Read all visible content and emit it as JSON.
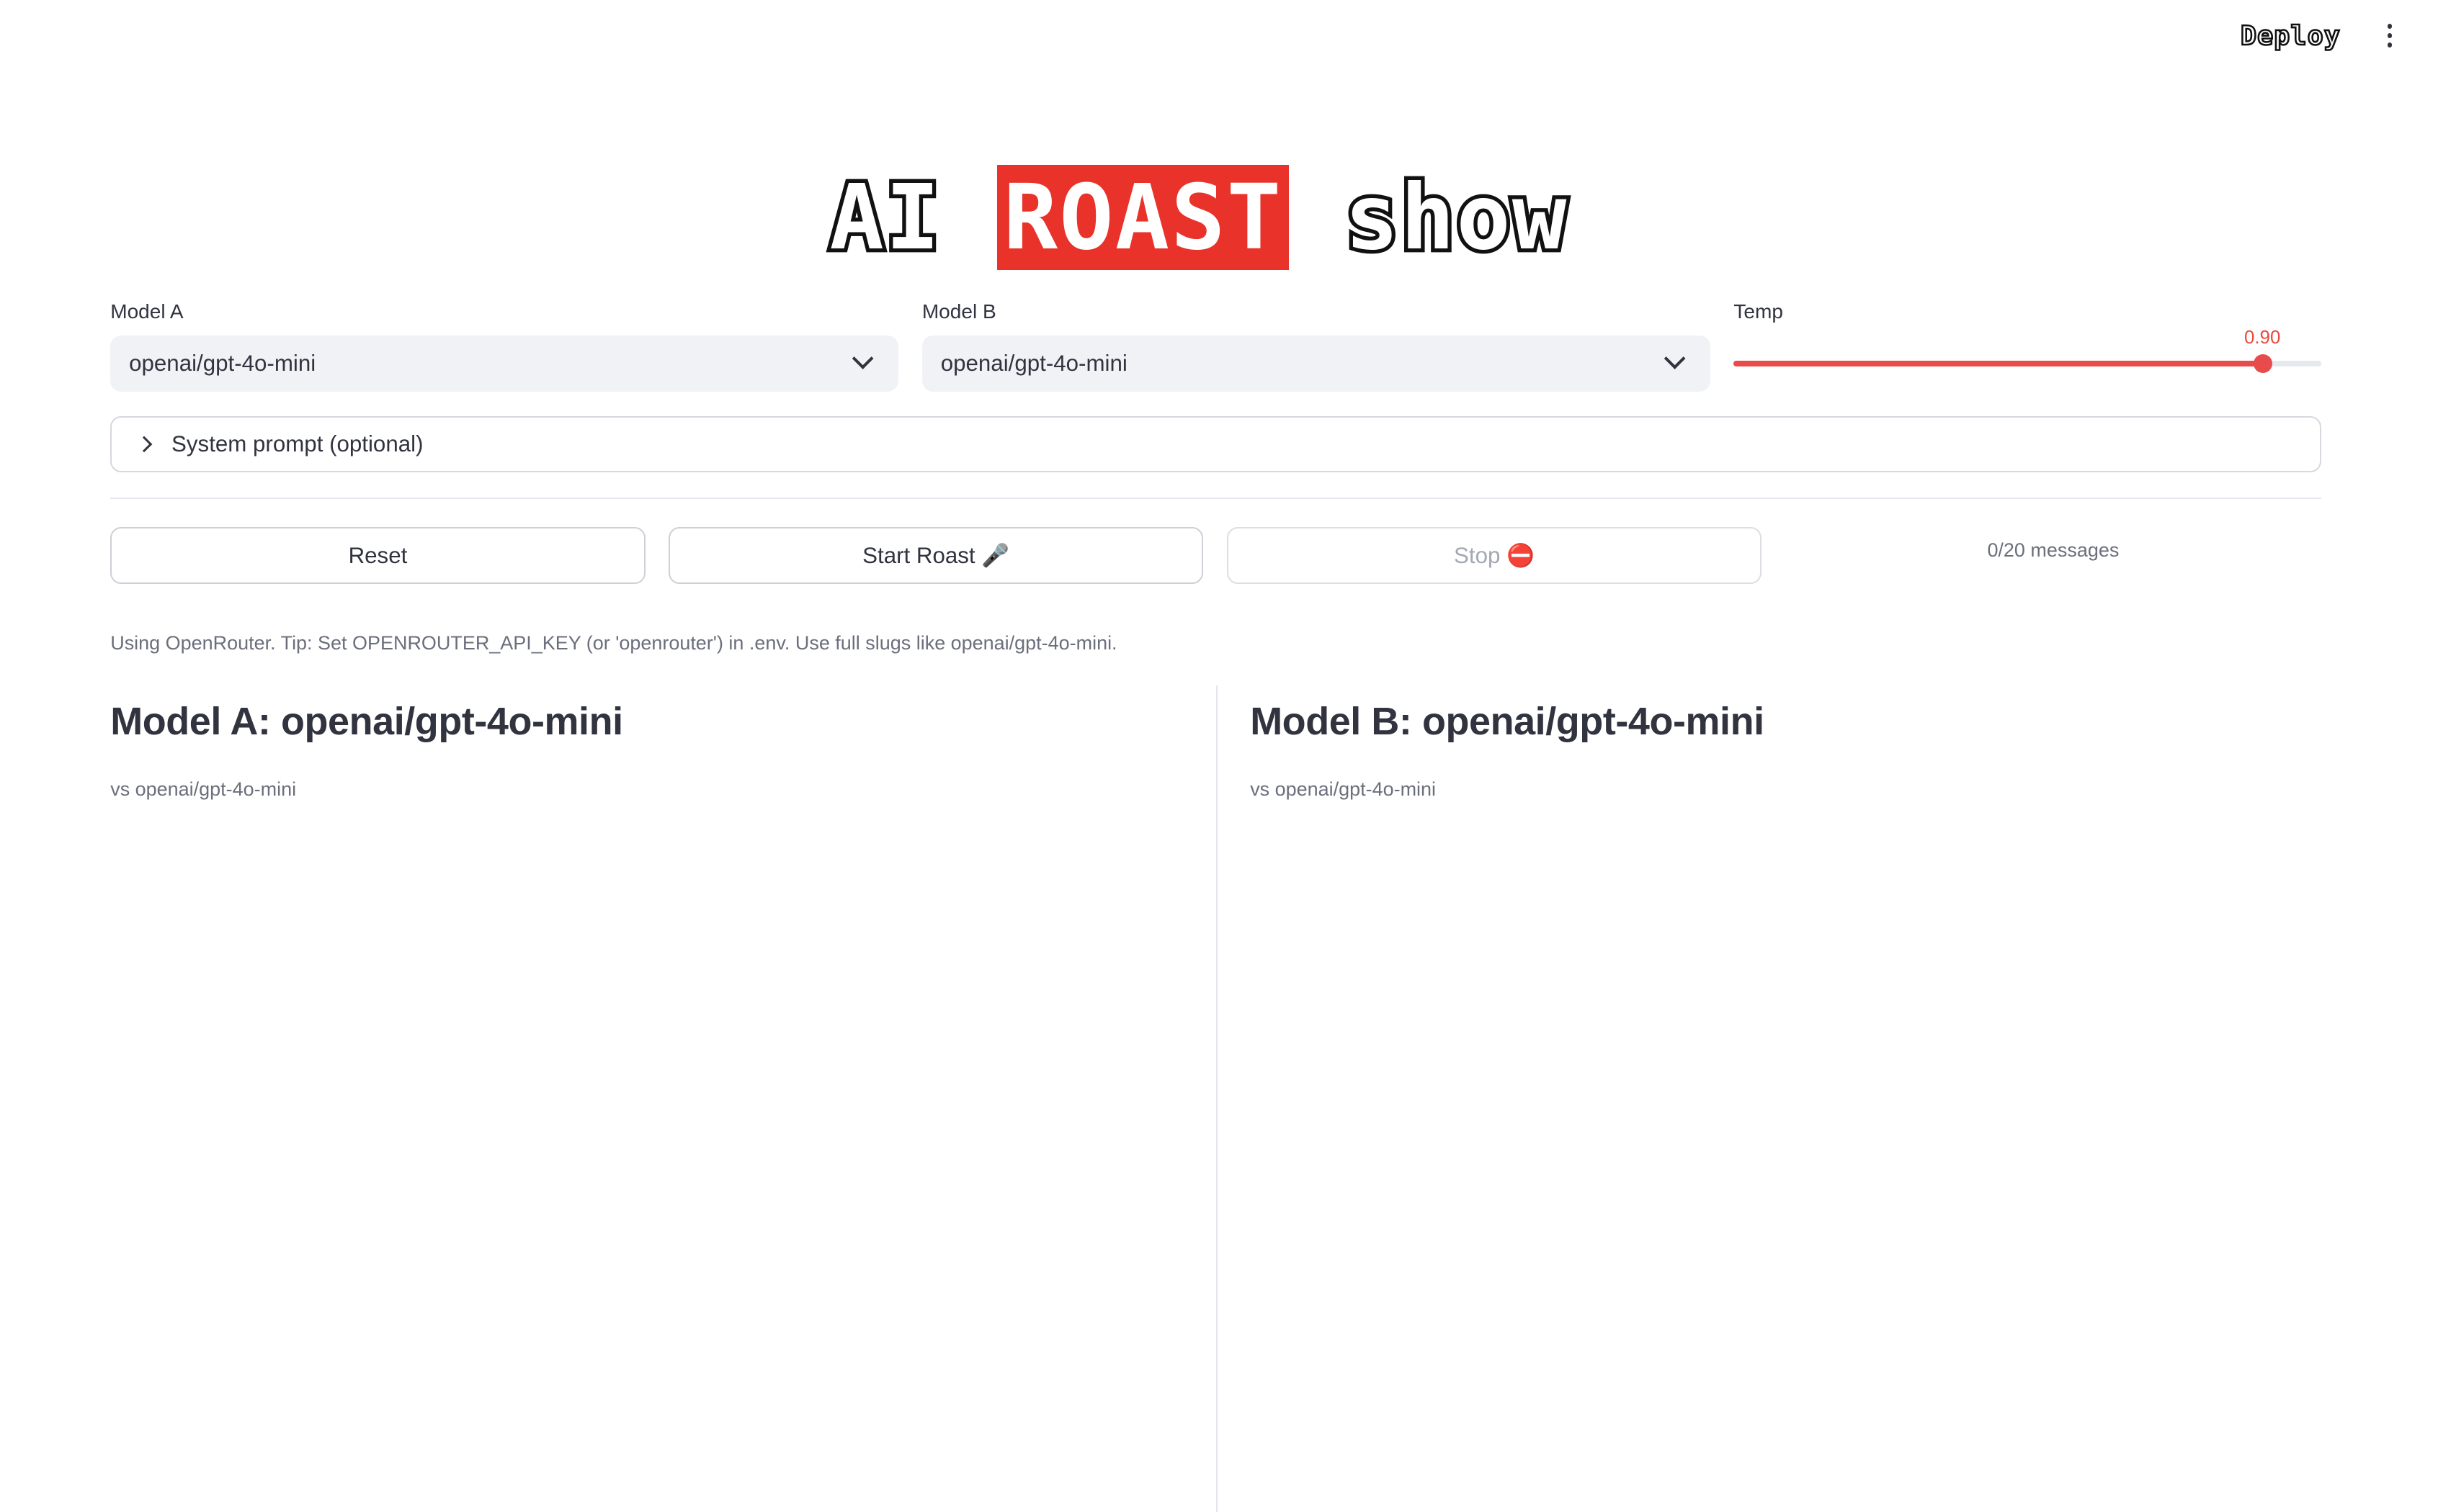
{
  "header": {
    "deploy_label": "Deploy",
    "menu_icon": "kebab-menu-icon"
  },
  "title": {
    "part1": "AI ",
    "part2": "ROAST",
    "part3": " show",
    "accent_color": "#e8322a"
  },
  "controls": {
    "model_a": {
      "label": "Model A",
      "value": "openai/gpt-4o-mini"
    },
    "model_b": {
      "label": "Model B",
      "value": "openai/gpt-4o-mini"
    },
    "temp": {
      "label": "Temp",
      "value": 0.9,
      "value_text": "0.90",
      "fill_fraction": 0.9,
      "color": "#e84b4b"
    }
  },
  "system_prompt": {
    "label": "System prompt (optional)"
  },
  "buttons": {
    "reset": "Reset",
    "start": "Start Roast 🎤",
    "stop": "Stop ⛔"
  },
  "counter": "0/20 messages",
  "caption": "Using OpenRouter. Tip: Set OPENROUTER_API_KEY (or 'openrouter') in .env. Use full slugs like openai/gpt-4o-mini.",
  "columns": {
    "a": {
      "heading": "Model A: openai/gpt-4o-mini",
      "sub": "vs openai/gpt-4o-mini"
    },
    "b": {
      "heading": "Model B: openai/gpt-4o-mini",
      "sub": "vs openai/gpt-4o-mini"
    }
  }
}
